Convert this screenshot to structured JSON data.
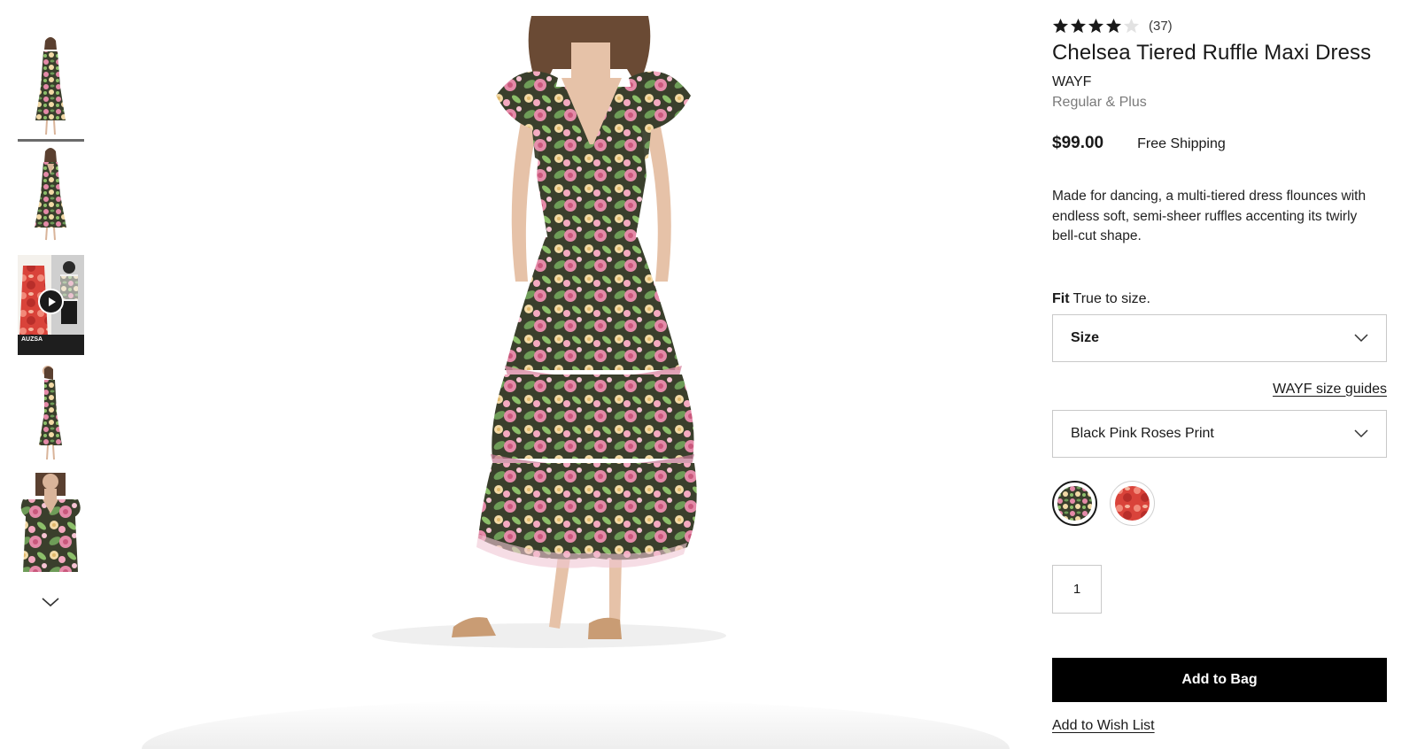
{
  "gallery": {
    "thumbnails": [
      {
        "kind": "front",
        "active": true
      },
      {
        "kind": "back",
        "active": false
      },
      {
        "kind": "video",
        "active": false,
        "video_caption": "AUZSA"
      },
      {
        "kind": "side",
        "active": false
      },
      {
        "kind": "detail",
        "active": false
      }
    ],
    "scroll_icon": "chevron-down-icon",
    "video_icon": "play-icon"
  },
  "product": {
    "rating": 4,
    "rating_max": 5,
    "review_count": "(37)",
    "title": "Chelsea Tiered Ruffle Maxi Dress",
    "brand": "WAYF",
    "fit_range": "Regular & Plus",
    "price": "$99.00",
    "shipping": "Free Shipping",
    "description": "Made for dancing, a multi-tiered dress flounces with endless soft, semi-sheer ruffles accenting its twirly bell-cut shape."
  },
  "options": {
    "fit_label": "Fit",
    "fit_value": "True to size.",
    "size_select": "Size",
    "size_guide_link": "WAYF size guides",
    "color_select": "Black Pink Roses Print",
    "swatches": [
      {
        "name": "Black Pink Roses Print",
        "selected": true
      },
      {
        "name": "Red Floral Print",
        "selected": false
      }
    ],
    "quantity": "1"
  },
  "actions": {
    "add_to_bag": "Add to Bag",
    "add_to_wishlist": "Add to Wish List"
  },
  "colors": {
    "text": "#191919",
    "muted": "#7a7a7a",
    "button_bg": "#000000",
    "button_text": "#ffffff",
    "border": "#c9c9c9",
    "dress_base": "#2e3a2a",
    "rose_pink": "#e48aa8",
    "leaf_green": "#6e9c58"
  }
}
